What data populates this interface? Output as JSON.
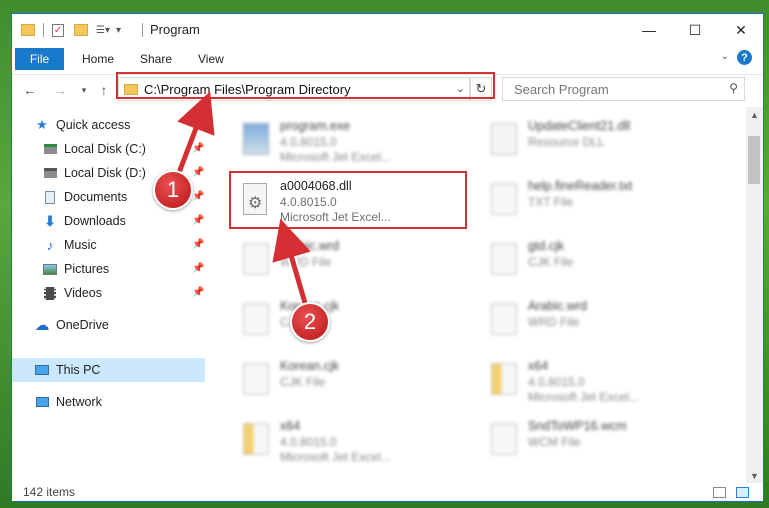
{
  "window": {
    "title": "Program",
    "controls": {
      "minimize": "—",
      "maximize": "☐",
      "close": "✕"
    }
  },
  "ribbon": {
    "tabs": [
      "File",
      "Home",
      "Share",
      "View"
    ],
    "help": "?"
  },
  "address": {
    "path": "C:\\Program Files\\Program Directory",
    "search_placeholder": "Search Program"
  },
  "sidebar": {
    "items": [
      {
        "label": "Quick access",
        "icon": "star-icon"
      },
      {
        "label": "Local Disk (C:)",
        "icon": "drive-icon",
        "pinned": true
      },
      {
        "label": "Local Disk (D:)",
        "icon": "drive-icon",
        "pinned": true
      },
      {
        "label": "Documents",
        "icon": "documents-icon",
        "pinned": true
      },
      {
        "label": "Downloads",
        "icon": "download-icon",
        "pinned": true
      },
      {
        "label": "Music",
        "icon": "music-icon",
        "pinned": true
      },
      {
        "label": "Pictures",
        "icon": "pictures-icon",
        "pinned": true
      },
      {
        "label": "Videos",
        "icon": "videos-icon",
        "pinned": true
      },
      {
        "label": "OneDrive",
        "icon": "cloud-icon"
      },
      {
        "label": "This PC",
        "icon": "computer-icon",
        "selected": true
      },
      {
        "label": "Network",
        "icon": "network-icon"
      }
    ]
  },
  "files": [
    {
      "name": "program.exe",
      "line1": "4.0.8015.0",
      "line2": "Microsoft Jet Excel...",
      "icon": "program-icon",
      "blurred": true
    },
    {
      "name": "UpdateClient21.dll",
      "line1": "Resource DLL",
      "line2": "",
      "icon": "dll-icon",
      "blurred": true
    },
    {
      "name": "a0004068.dll",
      "line1": "4.0.8015.0",
      "line2": "Microsoft Jet Excel...",
      "icon": "dll-gear-icon",
      "blurred": false
    },
    {
      "name": "help.fineReader.txt",
      "line1": "TXT File",
      "line2": "",
      "icon": "document-icon",
      "blurred": true
    },
    {
      "name": "Arabic.wrd",
      "line1": "WRD File",
      "line2": "",
      "icon": "document-icon",
      "blurred": true
    },
    {
      "name": "gtd.cjk",
      "line1": "CJK File",
      "line2": "",
      "icon": "document-icon",
      "blurred": true
    },
    {
      "name": "Korean.cjk",
      "line1": "CJK File",
      "line2": "",
      "icon": "document-icon",
      "blurred": true
    },
    {
      "name": "Arabic.wrd",
      "line1": "WRD File",
      "line2": "",
      "icon": "document-icon",
      "blurred": true
    },
    {
      "name": "Korean.cjk",
      "line1": "CJK File",
      "line2": "",
      "icon": "document-icon",
      "blurred": true
    },
    {
      "name": "x64",
      "line1": "4.0.8015.0",
      "line2": "Microsoft Jet Excel...",
      "icon": "folder-file-icon",
      "blurred": true
    },
    {
      "name": "x64",
      "line1": "4.0.8015.0",
      "line2": "Microsoft Jet Excel...",
      "icon": "folder-file-icon",
      "blurred": true
    },
    {
      "name": "SndToWP16.wcm",
      "line1": "WCM File",
      "line2": "",
      "icon": "document-icon",
      "blurred": true
    }
  ],
  "status": {
    "count": "142 items"
  },
  "annotations": {
    "step1": "1",
    "step2": "2"
  },
  "colors": {
    "accent": "#1979ca",
    "selection": "#cce8ff",
    "highlight": "#d42f32"
  }
}
